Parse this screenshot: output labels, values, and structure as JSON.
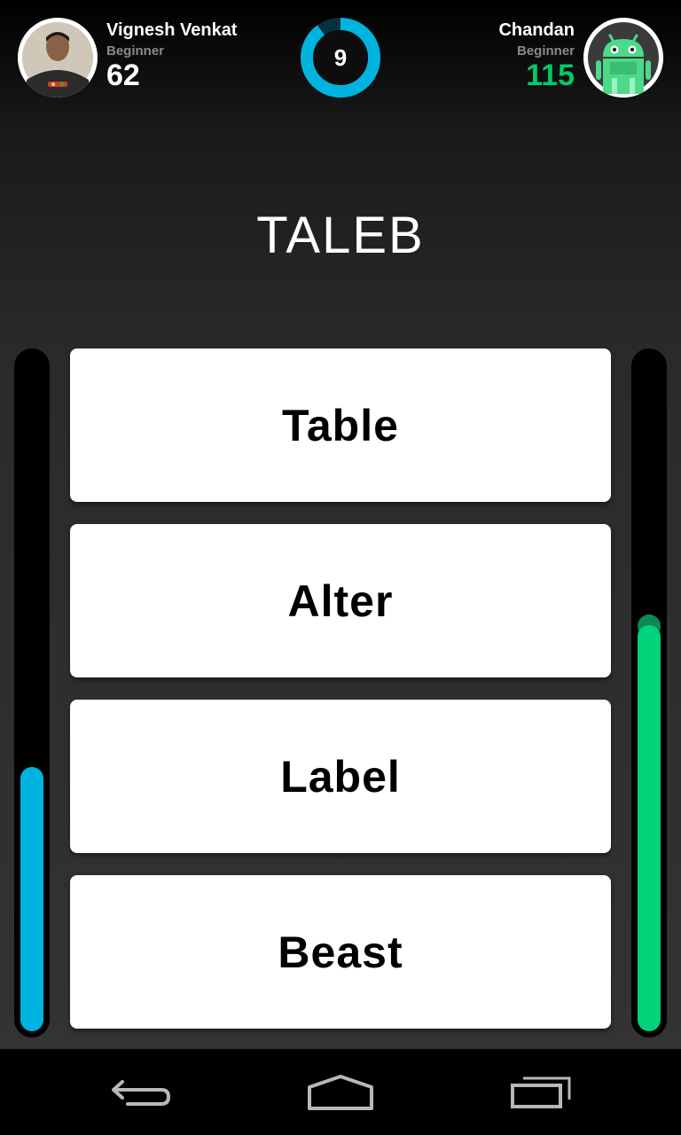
{
  "players": {
    "left": {
      "name": "Vignesh Venkat",
      "level": "Beginner",
      "score": "62",
      "progress": 0.39,
      "bar_color": "#00b4e0"
    },
    "right": {
      "name": "Chandan",
      "level": "Beginner",
      "score": "115",
      "score_color": "#00cc66",
      "progress": 0.6,
      "bar_color": "#00d27a",
      "avatar_icon": "android-robot-icon"
    }
  },
  "timer": {
    "value": "9",
    "remaining_fraction": 0.9,
    "color": "#00b4e0"
  },
  "question": {
    "word": "TALEB"
  },
  "answers": [
    {
      "label": "Table"
    },
    {
      "label": "Alter"
    },
    {
      "label": "Label"
    },
    {
      "label": "Beast"
    }
  ],
  "navbar": {
    "icons": [
      "back-icon",
      "home-icon",
      "recent-apps-icon"
    ]
  }
}
